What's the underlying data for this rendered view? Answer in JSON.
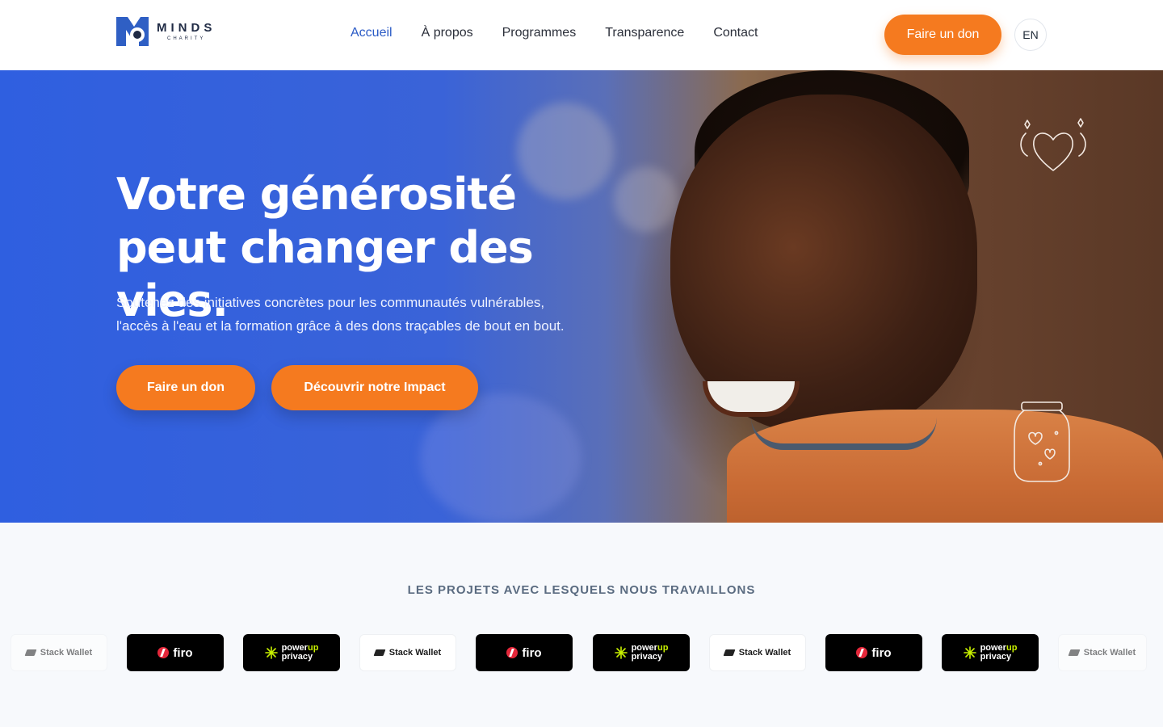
{
  "header": {
    "logo": {
      "name": "MINDS",
      "sub": "CHARITY"
    },
    "nav": [
      {
        "label": "Accueil",
        "active": true
      },
      {
        "label": "À propos",
        "active": false
      },
      {
        "label": "Programmes",
        "active": false
      },
      {
        "label": "Transparence",
        "active": false
      },
      {
        "label": "Contact",
        "active": false
      }
    ],
    "cta_label": "Faire un don",
    "lang_label": "EN"
  },
  "hero": {
    "title": "Votre générosité peut changer des vies.",
    "subtitle": "Soutenez des initiatives concrètes pour les communautés vulnérables, l'accès à l'eau et la formation grâce à des dons traçables de bout en bout.",
    "primary_button": "Faire un don",
    "secondary_button": "Découvrir notre Impact"
  },
  "partners": {
    "title": "LES PROJETS AVEC LESQUELS NOUS TRAVAILLONS",
    "logos": [
      {
        "name": "Stack Wallet",
        "style": "light"
      },
      {
        "name": "firo",
        "style": "dark"
      },
      {
        "name": "powerup privacy",
        "top": "power",
        "up": "up",
        "bottom": "privacy",
        "style": "dark"
      },
      {
        "name": "Stack Wallet",
        "style": "light"
      },
      {
        "name": "firo",
        "style": "dark"
      },
      {
        "name": "powerup privacy",
        "top": "power",
        "up": "up",
        "bottom": "privacy",
        "style": "dark"
      },
      {
        "name": "Stack Wallet",
        "style": "light"
      },
      {
        "name": "firo",
        "style": "dark"
      },
      {
        "name": "powerup privacy",
        "top": "power",
        "up": "up",
        "bottom": "privacy",
        "style": "dark"
      },
      {
        "name": "Stack Wallet",
        "style": "light"
      }
    ]
  },
  "colors": {
    "accent": "#f57a1f",
    "nav_active": "#2b5bc6",
    "hero_blue": "#2f5fe0"
  },
  "icons": [
    "minds-logo-icon",
    "heart-outline-icon",
    "jar-icon",
    "stack-wallet-icon",
    "firo-icon",
    "powerup-icon"
  ]
}
